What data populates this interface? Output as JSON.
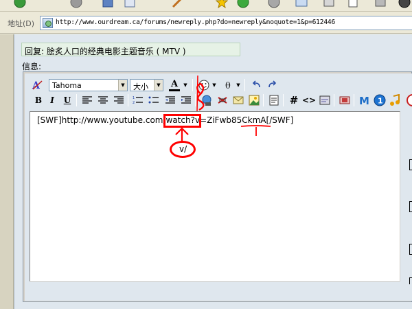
{
  "address_bar": {
    "label": "地址(D)",
    "url": "http://www.ourdream.ca/forums/newreply.php?do=newreply&noquote=1&p=612446"
  },
  "form": {
    "subject": "回复: 脍炙人口的经典电影主题音乐 ( MTV )",
    "message_label": "信息:"
  },
  "editor": {
    "font_name": "Tahoma",
    "font_size": "大小",
    "text_color_letter": "A",
    "bold": "B",
    "italic": "I",
    "underline": "U",
    "hash_tag": "#",
    "code_tag": "<>",
    "content": {
      "before_box": "[SWF]http://www.youtube.com/",
      "boxed": "watch?v=",
      "after_box": "ZiFwb85CkmA[/SWF]"
    }
  },
  "annotation": {
    "replacement_text": "v/",
    "color": "#ff0000"
  }
}
